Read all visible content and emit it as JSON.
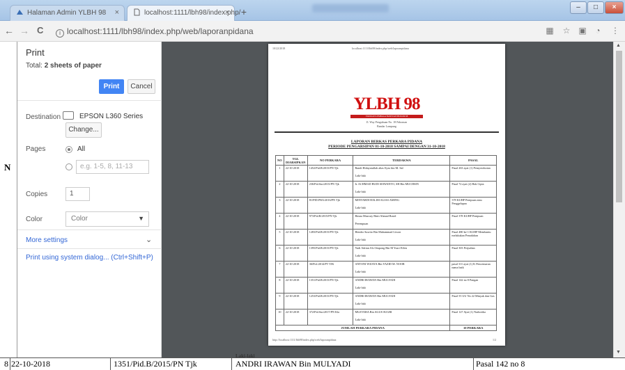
{
  "browser": {
    "tabs": [
      {
        "label": "Halaman Admin YLBH 98",
        "close": "×"
      },
      {
        "label": "localhost:1111/lbh98/index.php/",
        "close": "×"
      }
    ],
    "new_tab": "+",
    "window_controls": {
      "minimize": "–",
      "maximize": "□",
      "close": "×"
    },
    "nav": {
      "back": "←",
      "forward": "→",
      "reload": "C"
    },
    "address": "localhost:1111/lbh98/index.php/web/laporanpidana",
    "address_icon": "i"
  },
  "print_panel": {
    "title": "Print",
    "total_label": "Total:",
    "total_value": "2 sheets of paper",
    "print_button": "Print",
    "cancel_button": "Cancel",
    "destination_label": "Destination",
    "destination_value": "EPSON L360 Series",
    "change_button": "Change...",
    "pages_label": "Pages",
    "pages_all": "All",
    "pages_placeholder": "e.g. 1-5, 8, 11-13",
    "copies_label": "Copies",
    "copies_value": "1",
    "color_label": "Color",
    "color_value": "Color",
    "more_settings": "More settings",
    "system_dialog": "Print using system dialog... (Ctrl+Shift+P)"
  },
  "document": {
    "header_date": "10/22/2018",
    "header_url": "localhost:1111/lbh98/index.php/web/laporanpidana",
    "logo": "YLBH 98",
    "logo_sub": "YAYASAN LEMBAGA BANTUAN HUKUM 98",
    "address_line1": "Jl. Way Pengubuan No. 18 Pahoman",
    "address_line2": "Bandar Lampung",
    "report_title": "LAPORAN BERKAS PERKARA PIDANA",
    "report_period": "PERIODE PENGARSIPAN 01-10-2018 SAMPAI DENGAN 31-10-2018",
    "columns": [
      "NO",
      "TGL DIARSIPKAN",
      "NO PERKARA",
      "TERDAKWA",
      "PASAL"
    ],
    "rows": [
      {
        "no": "1",
        "tgl": "22-10-2018",
        "perkara": "1452/Pid.B/2015/PN Tjk",
        "terdakwa": "Randi Hidayatullah alias Ilyas bin M. Sal",
        "jk": "Laki-laki",
        "pasal": "Pasal 263 ayat (1) Pemyerobotan"
      },
      {
        "no": "2",
        "tgl": "22-10-2018",
        "perkara": "236/Pid.Sus/2015/PN Tjk",
        "terdakwa": "Ir. ACHMAD BUDI SISWANTO, SH Bin MUCHSIN",
        "jk": "Laki-laki",
        "pasal": "Pasal 72 ayat (2) Hak Cipta"
      },
      {
        "no": "3",
        "tgl": "22-10-2018",
        "perkara": "81/PID.PRA/2016/PN Tjk",
        "terdakwa": "MINTARDI HALIM ALIAS AMING",
        "jk": "Laki-laki",
        "pasal": "378 KUHP Penipuan atau Penggelapan"
      },
      {
        "no": "4",
        "tgl": "22-10-2018",
        "perkara": "973/Pid.B/2015/PN Tjk",
        "terdakwa": "Hasna Masrury Binti Ahmad Rasid",
        "jk": "Perempuan",
        "pasal": "Pasal 378 KUHP Penipuan"
      },
      {
        "no": "5",
        "tgl": "22-10-2018",
        "perkara": "1283/Pid.B/2015/PN Tjk",
        "terdakwa": "Hendro Suwito Bin Muhammad Liwon",
        "jk": "Laki-laki",
        "pasal": "Pasal 480 ke-1 KUHP Membantu melakukan Penadahan"
      },
      {
        "no": "6",
        "tgl": "22-10-2018",
        "perkara": "1395/Pid.B/2015/PN Tjk",
        "terdakwa": "Yudi Adrian Als Ompong Bin M Yusri Effen",
        "jk": "Laki-laki",
        "pasal": "Pasal 303 Perjudian"
      },
      {
        "no": "7",
        "tgl": "22-10-2018",
        "perkara": "36/Pid./2014/PT TJK",
        "terdakwa": "ANTONI WIJAYA Bin YAZID M. NOOR",
        "jk": "Laki-laki",
        "pasal": "pasal 311 ayat (1) K Pencemaran nama baik"
      },
      {
        "no": "8",
        "tgl": "22-10-2018",
        "perkara": "1351/Pid.B/2015/PN Tjk",
        "terdakwa": "ANDRI IRAWAN Bin MULYADI",
        "jk": "Laki-laki",
        "pasal": "Pasal 142 no 8 Pangan"
      },
      {
        "no": "9",
        "tgl": "22-10-2018",
        "perkara": "1253/Pid.B/2015/PN Tjk",
        "terdakwa": "ANDRI IRAWAN Bin MULYADI",
        "jk": "Laki-laki",
        "pasal": "Pasal 55 UU No 22 Minyak dan Gas"
      },
      {
        "no": "10",
        "tgl": "22-10-2018",
        "perkara": "372/Pid.Sus/2017/PN Kla",
        "terdakwa": "MUZTABA Bin AGUS SUGRI",
        "jk": "Laki-laki",
        "pasal": "Pasal 127 Ayat (1) Narkotika"
      }
    ],
    "total_label": "JUMLAH PERKARA PIDANA",
    "total_value": "10 PERKARA",
    "footer_url": "http://localhost:1111/lbh98/index.php/web/laporanpidana",
    "footer_page": "1/2"
  },
  "background": {
    "left_marks": [
      "N"
    ],
    "bottom_row": {
      "no": "8",
      "tgl": "22-10-2018",
      "perkara": "1351/Pid.B/2015/PN Tjk",
      "terdakwa": "ANDRI IRAWAN Bin MULYADI",
      "pasal": "Pasal 142 no 8",
      "above": "Laki-laki"
    }
  }
}
